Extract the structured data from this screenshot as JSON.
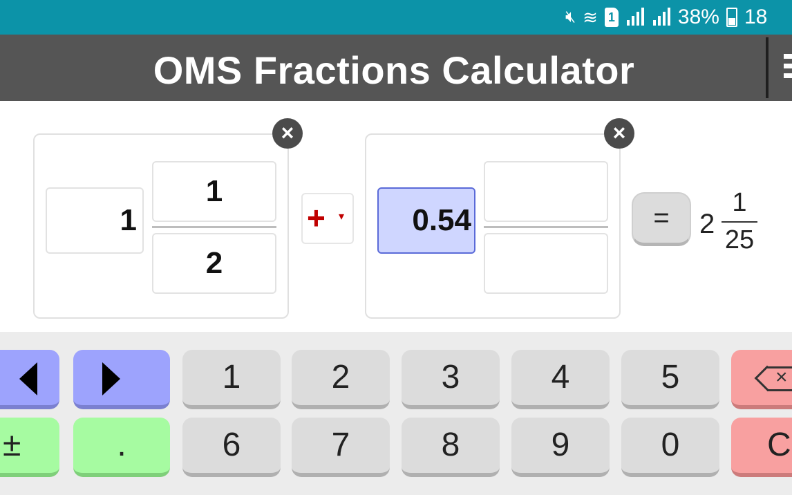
{
  "status_bar": {
    "battery_percent": "38%",
    "clock_partial": "18",
    "sim_label": "1",
    "icons": [
      "mute-icon",
      "wifi-icon",
      "sim-icon",
      "signal-icon",
      "signal-icon",
      "battery-icon"
    ]
  },
  "app_bar": {
    "title": "OMS Fractions Calculator",
    "menu_icon": "menu-icon"
  },
  "operand1": {
    "whole": "1",
    "numerator": "1",
    "denominator": "2",
    "clear_icon": "×"
  },
  "operator": {
    "symbol": "+",
    "caret": "▾"
  },
  "operand2": {
    "whole": "0.54",
    "numerator": "",
    "denominator": "",
    "clear_icon": "×"
  },
  "equals_label": "=",
  "result": {
    "whole": "2",
    "numerator": "1",
    "denominator": "25"
  },
  "keypad": {
    "row1": [
      "1",
      "2",
      "3",
      "4",
      "5"
    ],
    "row2": [
      "6",
      "7",
      "8",
      "9",
      "0"
    ],
    "plus_minus": "±",
    "decimal": ".",
    "clear": "C"
  },
  "colors": {
    "status_bar": "#0c93a8",
    "title_bar": "#555555",
    "key_gray": "#dcdcdc",
    "key_blue": "#9da3fd",
    "key_green": "#a6fba1",
    "key_red": "#f8a0a0",
    "operator_red": "#c00000",
    "active_field": "#cfd6ff"
  }
}
